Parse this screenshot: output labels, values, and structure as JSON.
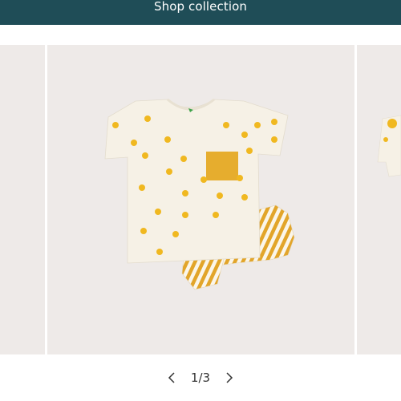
{
  "banner": {
    "label": "Shop collection",
    "background": "#1f4d57"
  },
  "gallery": {
    "background": "#eeeae8",
    "zoom": {
      "icon": "search-icon"
    },
    "product": {
      "tee_color": "#f6f1e6",
      "pocket_color": "#e6ad2e",
      "stripe_color": "#e2a52a",
      "print_color": "#f0b820"
    }
  },
  "pager": {
    "current": "1/3",
    "prev_icon": "chevron-left-icon",
    "next_icon": "chevron-right-icon"
  }
}
